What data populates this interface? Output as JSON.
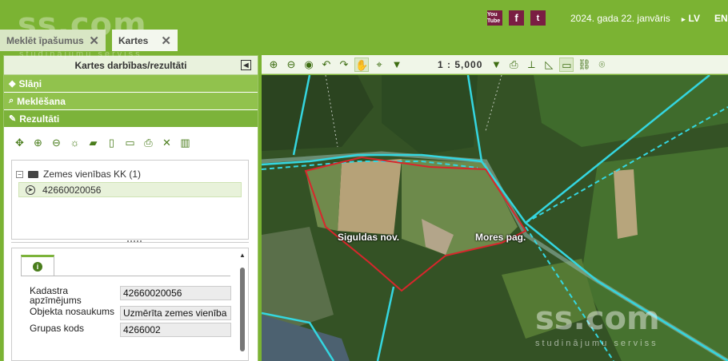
{
  "header": {
    "brand": "ss.com",
    "brand_sub": "studinājumu serviss",
    "social": [
      "You Tube",
      "f",
      "t"
    ],
    "date": "2024. gada 22. janvāris",
    "languages": [
      "LV",
      "EN"
    ]
  },
  "tabs": [
    {
      "label": "Meklēt īpašumus",
      "close": "✕"
    },
    {
      "label": "Kartes",
      "close": "✕"
    }
  ],
  "left_panel": {
    "title": "Kartes darbības/rezultāti",
    "sections": [
      "Slāņi",
      "Meklēšana",
      "Rezultāti"
    ],
    "tree": {
      "group_label": "Zemes vienības KK (1)",
      "item_label": "42660020056"
    },
    "details": {
      "fields": [
        {
          "label": "Kadastra apzīmējums",
          "value": "42660020056"
        },
        {
          "label": "Objekta nosaukums",
          "value": "Uzmērīta zemes vienība"
        },
        {
          "label": "Grupas kods",
          "value": "4266002"
        }
      ]
    }
  },
  "map": {
    "scale": "1 : 5,000",
    "labels": [
      "Siguldas nov.",
      "Mores pag."
    ],
    "watermark": "ss.com",
    "watermark_sub": "studinājumu serviss"
  },
  "colors": {
    "header_green": "#7bb333",
    "parcel_outline": "#d8262c",
    "boundary_cyan": "#34d6e0"
  }
}
